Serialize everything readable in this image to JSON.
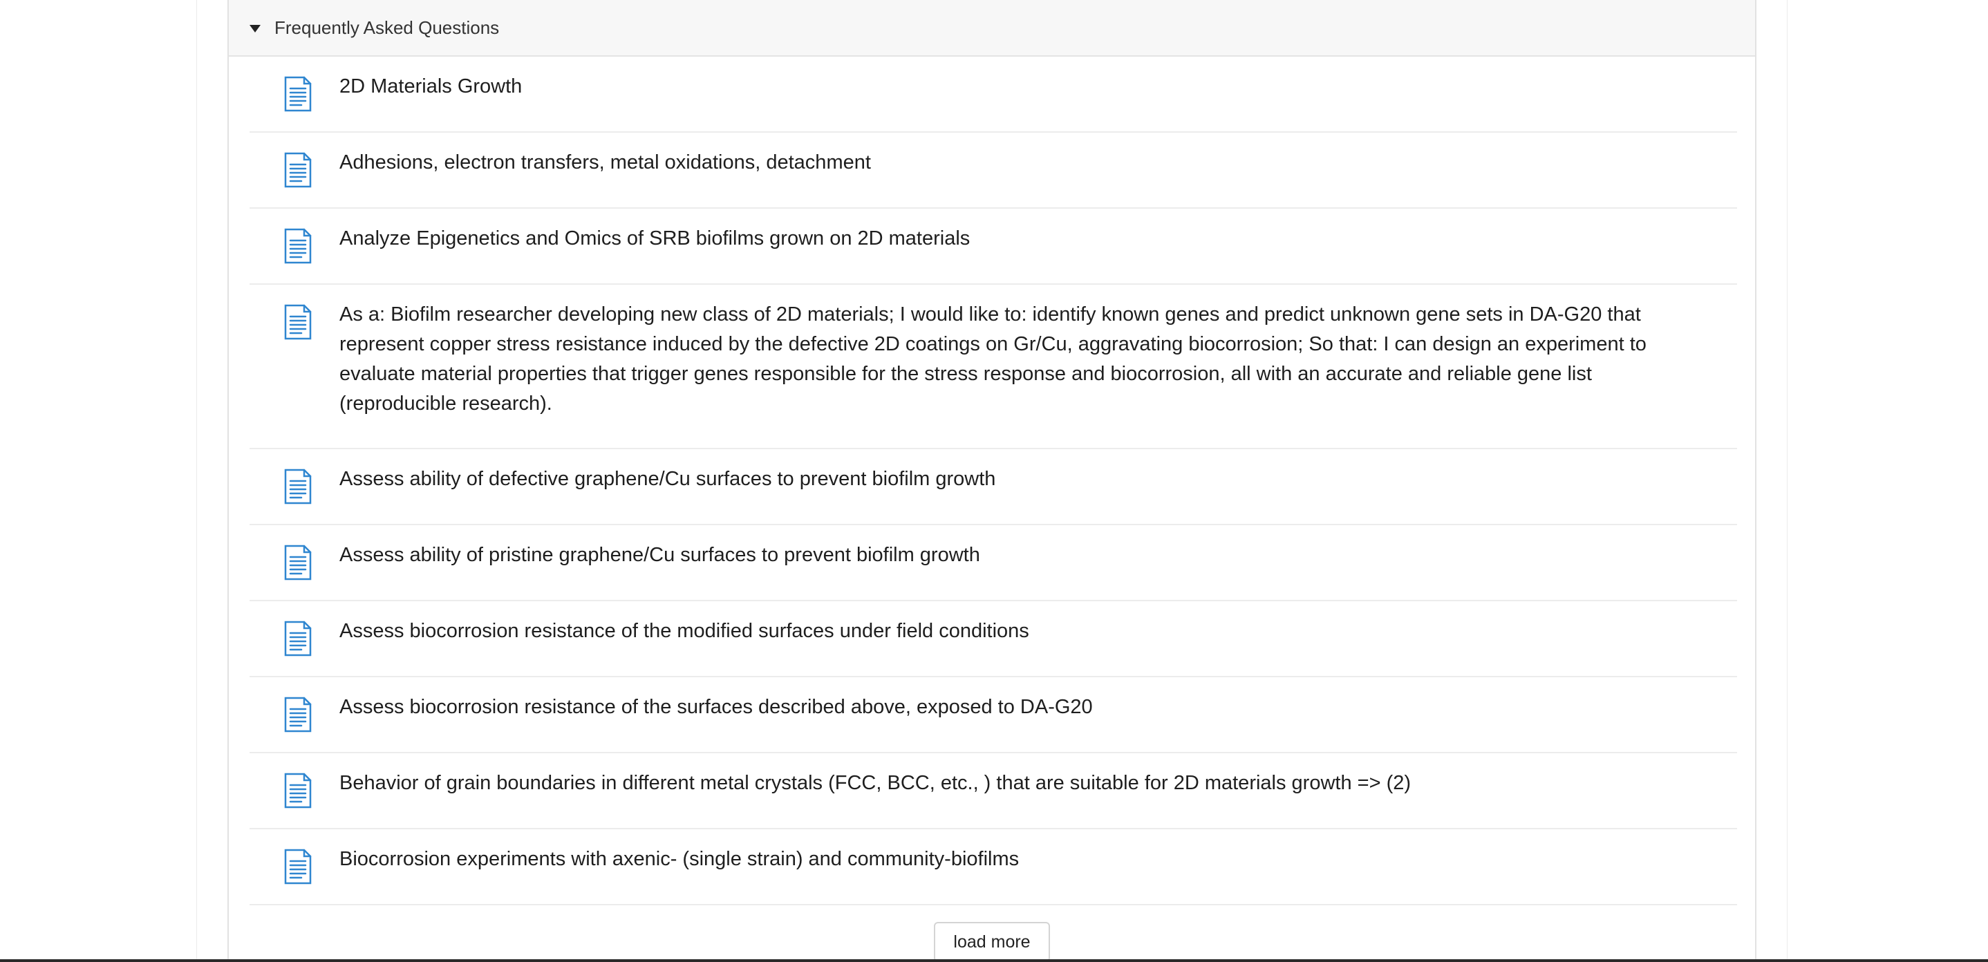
{
  "section": {
    "title": "Frequently Asked Questions"
  },
  "icons": {
    "item_icon": "document-lines-icon",
    "toggle_icon": "caret-down-icon",
    "icon_color": "#2f86d0"
  },
  "items": [
    {
      "text": "2D Materials Growth"
    },
    {
      "text": "Adhesions, electron transfers, metal oxidations, detachment"
    },
    {
      "text": "Analyze Epigenetics and Omics of SRB biofilms grown on 2D materials"
    },
    {
      "text": "As a: Biofilm researcher developing new class of 2D materials; I would like to: identify known genes and predict unknown gene sets in DA-G20 that represent copper stress resistance induced by the defective 2D coatings on Gr/Cu, aggravating biocorrosion; So that: I can design an experiment to evaluate material properties that trigger genes responsible for the stress response and biocorrosion, all with an accurate and reliable gene list (reproducible research)."
    },
    {
      "text": "Assess ability of defective graphene/Cu surfaces to prevent biofilm growth"
    },
    {
      "text": "Assess ability of pristine graphene/Cu surfaces to prevent biofilm growth"
    },
    {
      "text": "Assess biocorrosion resistance of the modified surfaces under field conditions"
    },
    {
      "text": "Assess biocorrosion resistance of the surfaces described above, exposed to DA-G20"
    },
    {
      "text": "Behavior of grain boundaries in different metal crystals (FCC, BCC, etc., ) that are suitable for 2D materials growth => (2)"
    },
    {
      "text": "Biocorrosion experiments with axenic- (single strain) and community-biofilms"
    }
  ],
  "load_more_label": "load more"
}
